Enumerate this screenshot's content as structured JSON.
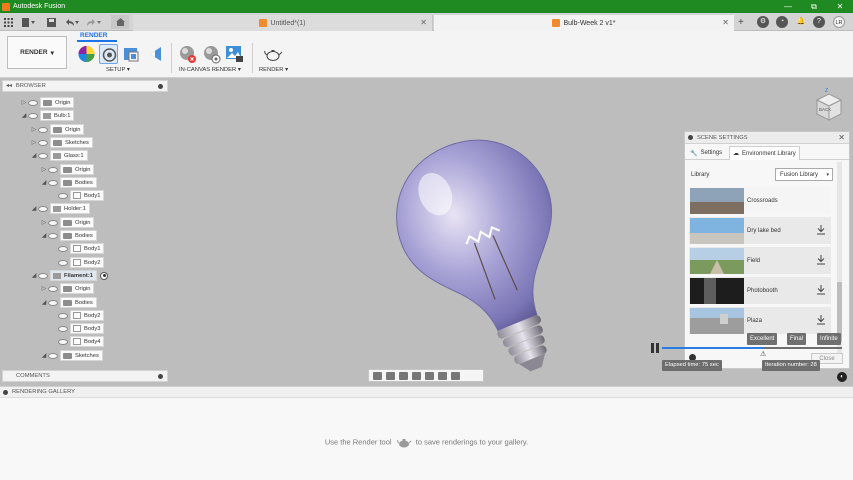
{
  "app": {
    "title": "Autodesk Fusion",
    "window_controls": [
      "—",
      "⧉",
      "✕"
    ]
  },
  "tabs": [
    {
      "label": "Untitled*(1)",
      "active": false
    },
    {
      "label": "Bulb-Week 2 v1*",
      "active": true
    }
  ],
  "user_initials": "LR",
  "ribbon": {
    "workspace_label": "RENDER",
    "active_tab": "RENDER",
    "groups": {
      "setup": "SETUP ▾",
      "in_canvas": "IN-CANVAS RENDER ▾",
      "render": "RENDER ▾"
    }
  },
  "browser": {
    "title": "BROWSER",
    "tree": [
      {
        "label": "Origin",
        "indent": 0,
        "arrow": "▷",
        "icon": "folder"
      },
      {
        "label": "Bulb:1",
        "indent": 0,
        "arrow": "◢",
        "icon": "component"
      },
      {
        "label": "Origin",
        "indent": 1,
        "arrow": "▷",
        "icon": "folder"
      },
      {
        "label": "Sketches",
        "indent": 1,
        "arrow": "▷",
        "icon": "folder"
      },
      {
        "label": "Glass:1",
        "indent": 1,
        "arrow": "◢",
        "icon": "component"
      },
      {
        "label": "Origin",
        "indent": 2,
        "arrow": "▷",
        "icon": "folder"
      },
      {
        "label": "Bodies",
        "indent": 2,
        "arrow": "◢",
        "icon": "folder"
      },
      {
        "label": "Body1",
        "indent": 3,
        "arrow": "",
        "icon": "body"
      },
      {
        "label": "Holder:1",
        "indent": 1,
        "arrow": "◢",
        "icon": "component"
      },
      {
        "label": "Origin",
        "indent": 2,
        "arrow": "▷",
        "icon": "folder"
      },
      {
        "label": "Bodies",
        "indent": 2,
        "arrow": "◢",
        "icon": "folder"
      },
      {
        "label": "Body1",
        "indent": 3,
        "arrow": "",
        "icon": "body"
      },
      {
        "label": "Body2",
        "indent": 3,
        "arrow": "",
        "icon": "body"
      },
      {
        "label": "Filament:1",
        "indent": 1,
        "arrow": "◢",
        "icon": "component",
        "active": true
      },
      {
        "label": "Origin",
        "indent": 2,
        "arrow": "▷",
        "icon": "folder"
      },
      {
        "label": "Bodies",
        "indent": 2,
        "arrow": "◢",
        "icon": "folder"
      },
      {
        "label": "Body2",
        "indent": 3,
        "arrow": "",
        "icon": "body"
      },
      {
        "label": "Body3",
        "indent": 3,
        "arrow": "",
        "icon": "body"
      },
      {
        "label": "Body4",
        "indent": 3,
        "arrow": "",
        "icon": "body"
      },
      {
        "label": "Sketches",
        "indent": 2,
        "arrow": "◢",
        "icon": "folder"
      }
    ]
  },
  "comments": {
    "title": "COMMENTS"
  },
  "viewcube": {
    "face": "BACK"
  },
  "scene_settings": {
    "title": "SCENE SETTINGS",
    "tabs": [
      "Settings",
      "Environment Library"
    ],
    "library_label": "Library",
    "library_value": "Fusion Library",
    "environments": [
      {
        "name": "Crossroads"
      },
      {
        "name": "Dry lake bed"
      },
      {
        "name": "Field"
      },
      {
        "name": "Photobooth"
      },
      {
        "name": "Plaza"
      }
    ],
    "close_label": "Close"
  },
  "render_progress": {
    "quality_levels": [
      "Excellent",
      "Final",
      "Infinite"
    ],
    "elapsed": "Elapsed time: 75 sec",
    "iteration": "Iteration number: 28",
    "progress_fraction": 0.56
  },
  "gallery": {
    "title": "RENDERING GALLERY",
    "message_before": "Use the Render tool",
    "message_after": "to save renderings to your gallery."
  },
  "colors": {
    "titlebar": "#1f8a21",
    "accent": "#1a73e8",
    "canvas": "#bdbdbd"
  }
}
